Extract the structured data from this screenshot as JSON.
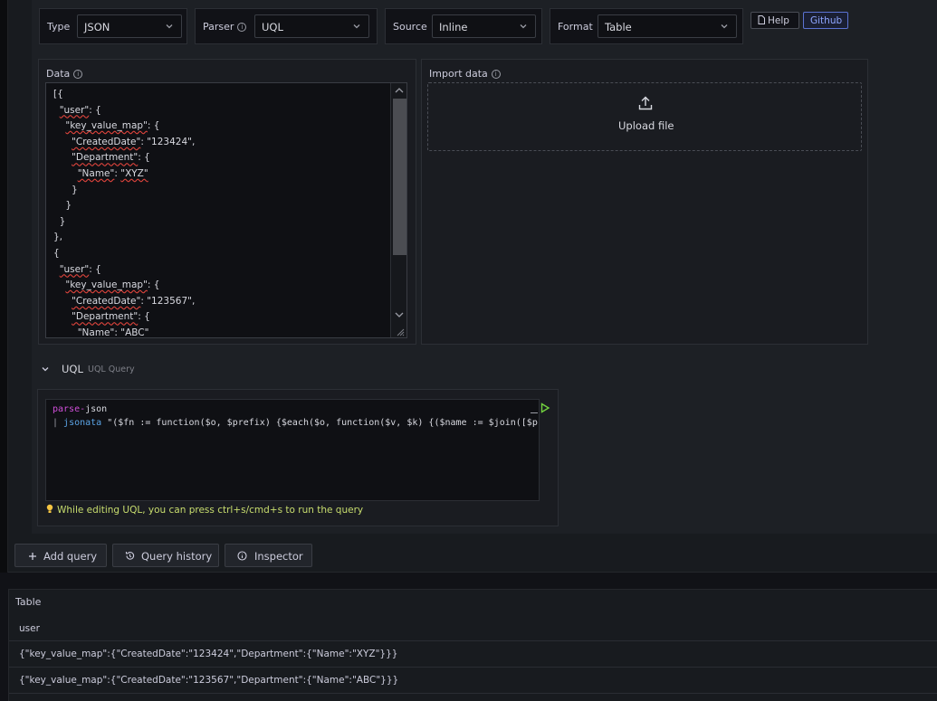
{
  "toolbar": {
    "type_label": "Type",
    "type_value": "JSON",
    "parser_label": "Parser",
    "parser_value": "UQL",
    "source_label": "Source",
    "source_value": "Inline",
    "format_label": "Format",
    "format_value": "Table",
    "help_label": "Help",
    "github_label": "Github"
  },
  "data_panel": {
    "title": "Data",
    "lines": [
      "[{",
      "  \"user\": {",
      "    \"key_value_map\": {",
      "      \"CreatedDate\": \"123424\",",
      "      \"Department\": {",
      "        \"Name\": \"XYZ\"",
      "      }",
      "    }",
      "  }",
      "},",
      "{",
      "  \"user\": {",
      "    \"key_value_map\": {",
      "      \"CreatedDate\": \"123567\",",
      "      \"Department\": {",
      "        \"Name\": \"ABC\""
    ]
  },
  "import_panel": {
    "title": "Import data",
    "upload_label": "Upload file",
    "upload_icon": "upload-icon"
  },
  "uql": {
    "section_label": "UQL",
    "section_sublabel": "UQL Query",
    "line1_kw": "parse-",
    "line1_rest": "json",
    "line2_pipe": "| ",
    "line2_kw": "jsonata",
    "line2_rest": " \"($fn := function($o, $prefix) {$each($o, function($v, $k) {($name := $join([$pr",
    "hint": "While editing UQL, you can press ctrl+s/cmd+s to run the query"
  },
  "actions": {
    "add_query": "Add query",
    "query_history": "Query history",
    "inspector": "Inspector"
  },
  "table": {
    "title": "Table",
    "header": "user",
    "rows": [
      "{\"key_value_map\":{\"CreatedDate\":\"123424\",\"Department\":{\"Name\":\"XYZ\"}}}",
      "{\"key_value_map\":{\"CreatedDate\":\"123567\",\"Department\":{\"Name\":\"ABC\"}}}"
    ]
  },
  "colors": {
    "accent_blue": "#8fa6ff",
    "hint_yellow": "#c8dd6e",
    "keyword_pink": "#d04fd9",
    "run_green": "#73d33f"
  }
}
